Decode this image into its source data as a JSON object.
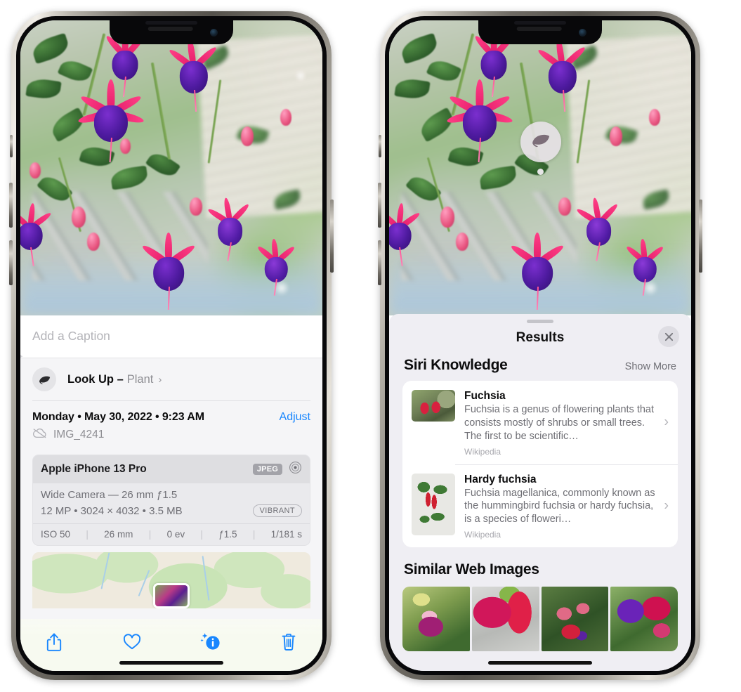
{
  "left_phone": {
    "name": "photo-details-screen",
    "caption_field": {
      "placeholder": "Add a Caption",
      "value": ""
    },
    "look_up": {
      "label": "Look Up –",
      "subject": "Plant",
      "chevron": "›",
      "icon": "leaf-icon"
    },
    "metadata": {
      "date_line": "Monday • May 30, 2022 • 9:23 AM",
      "adjust_label": "Adjust",
      "filename": "IMG_4241",
      "cloud_icon": "cloud-slash-icon"
    },
    "exif": {
      "device": "Apple iPhone 13 Pro",
      "format_badge": "JPEG",
      "aperture_icon": "aperture-icon",
      "lens": "Wide Camera — 26 mm ƒ1.5",
      "dimensions": "12 MP • 3024 × 4032 • 3.5 MB",
      "style_badge": "VIBRANT",
      "stats": [
        "ISO 50",
        "26 mm",
        "0 ev",
        "ƒ1.5",
        "1/181 s"
      ]
    },
    "toolbar": [
      {
        "name": "share-button",
        "icon": "share-icon"
      },
      {
        "name": "favorite-button",
        "icon": "heart-icon"
      },
      {
        "name": "info-button",
        "icon": "info-sparkle-icon"
      },
      {
        "name": "delete-button",
        "icon": "trash-icon"
      }
    ],
    "accent_color": "#1886fe"
  },
  "right_phone": {
    "name": "visual-look-up-results-screen",
    "vlu_badge": {
      "icon": "leaf-icon"
    },
    "sheet": {
      "title": "Results",
      "close_icon": "close-icon",
      "sections": [
        {
          "title": "Siri Knowledge",
          "action": "Show More",
          "items": [
            {
              "title": "Fuchsia",
              "description": "Fuchsia is a genus of flowering plants that consists mostly of shrubs or small trees. The first to be scientific…",
              "source": "Wikipedia",
              "thumb": "fuchsia-red-thumb",
              "chevron": "›"
            },
            {
              "title": "Hardy fuchsia",
              "description": "Fuchsia magellanica, commonly known as the hummingbird fuchsia or hardy fuchsia, is a species of floweri…",
              "source": "Wikipedia",
              "thumb": "hardy-fuchsia-specimen-thumb",
              "chevron": "›"
            }
          ]
        },
        {
          "title": "Similar Web Images",
          "images": [
            "fuchsia-web-image-1",
            "fuchsia-web-image-2",
            "fuchsia-web-image-3",
            "fuchsia-web-image-4"
          ]
        }
      ]
    },
    "panel_color": "#efeef3"
  }
}
